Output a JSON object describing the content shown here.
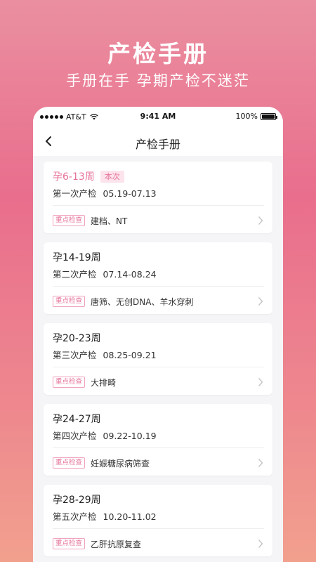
{
  "promo": {
    "title": "产检手册",
    "subtitle": "手册在手  孕期产检不迷茫"
  },
  "status_bar": {
    "carrier": "AT&T",
    "time": "9:41 AM",
    "battery": "100%"
  },
  "nav": {
    "back_icon": "chevron-left-icon",
    "title": "产检手册"
  },
  "exams": [
    {
      "weeks": "孕6-13周",
      "badge": "本次",
      "name": "第一次产检",
      "dates": "05.19-07.13",
      "tag": "重点检查",
      "items": "建档、NT"
    },
    {
      "weeks": "孕14-19周",
      "badge": "",
      "name": "第二次产检",
      "dates": "07.14-08.24",
      "tag": "重点检查",
      "items": "唐筛、无创DNA、羊水穿刺"
    },
    {
      "weeks": "孕20-23周",
      "badge": "",
      "name": "第三次产检",
      "dates": "08.25-09.21",
      "tag": "重点检查",
      "items": "大排畸"
    },
    {
      "weeks": "孕24-27周",
      "badge": "",
      "name": "第四次产检",
      "dates": "09.22-10.19",
      "tag": "重点检查",
      "items": "妊娠糖尿病筛查"
    },
    {
      "weeks": "孕28-29周",
      "badge": "",
      "name": "第五次产检",
      "dates": "10.20-11.02",
      "tag": "重点检查",
      "items": "乙肝抗原复查"
    }
  ],
  "colors": {
    "accent": "#e6739a",
    "badge_bg": "#fde3ec",
    "background_top": "#ea8fa0",
    "background_bottom": "#f2a08e"
  }
}
